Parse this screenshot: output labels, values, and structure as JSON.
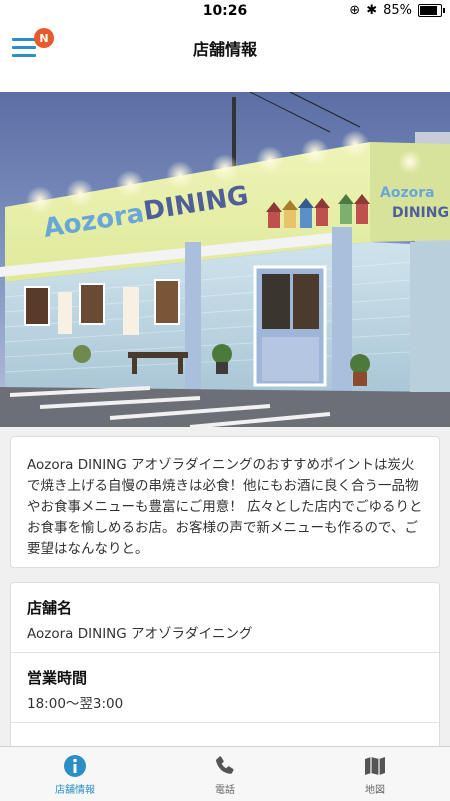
{
  "status_bar": {
    "time": "10:26",
    "battery": "85%",
    "battery_level": 0.85
  },
  "nav": {
    "title": "店舗情報",
    "badge": "N"
  },
  "hero": {
    "sign_text": "Aozora DINING",
    "sign_text_right": "Aozora DINING"
  },
  "description": "Aozora DINING アオゾラダイニングのおすすめポイントは炭火で焼き上げる自慢の串焼きは必食！他にもお酒に良く合う一品物やお食事メニューも豊富にご用意！ 広々とした店内でごゆるりとお食事を愉しめるお店。お客様の声で新メニューも作るので、ご要望はなんなりと。",
  "info": {
    "store_name_label": "店舗名",
    "store_name_value": "Aozora DINING アオゾラダイニング",
    "hours_label": "営業時間",
    "hours_value": "18:00〜翌3:00"
  },
  "tabs": [
    {
      "label": "店舗情報",
      "icon": "info-icon",
      "active": true
    },
    {
      "label": "電話",
      "icon": "phone-icon",
      "active": false
    },
    {
      "label": "地図",
      "icon": "map-icon",
      "active": false
    }
  ],
  "colors": {
    "accent": "#2b8ec4",
    "badge": "#e65a2b"
  }
}
